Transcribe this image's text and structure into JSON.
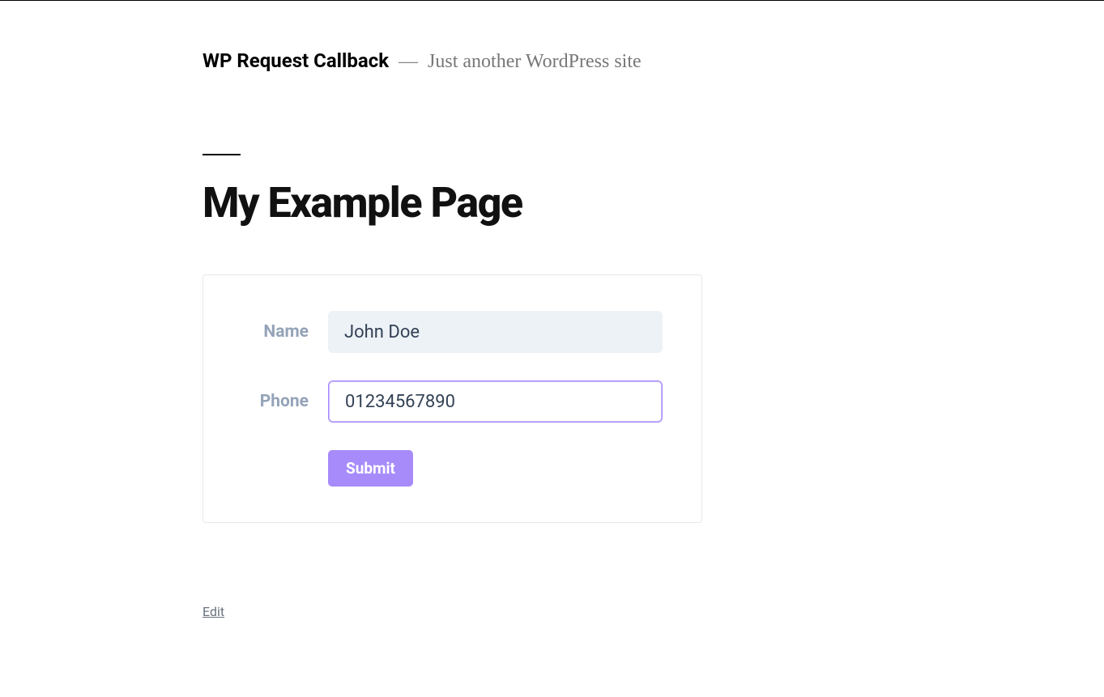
{
  "header": {
    "site_title": "WP Request Callback",
    "separator": "—",
    "tagline": "Just another WordPress site"
  },
  "page": {
    "title": "My Example Page"
  },
  "form": {
    "name_label": "Name",
    "name_value": "John Doe",
    "phone_label": "Phone",
    "phone_value": "01234567890",
    "submit_label": "Submit"
  },
  "footer": {
    "edit_label": "Edit"
  }
}
